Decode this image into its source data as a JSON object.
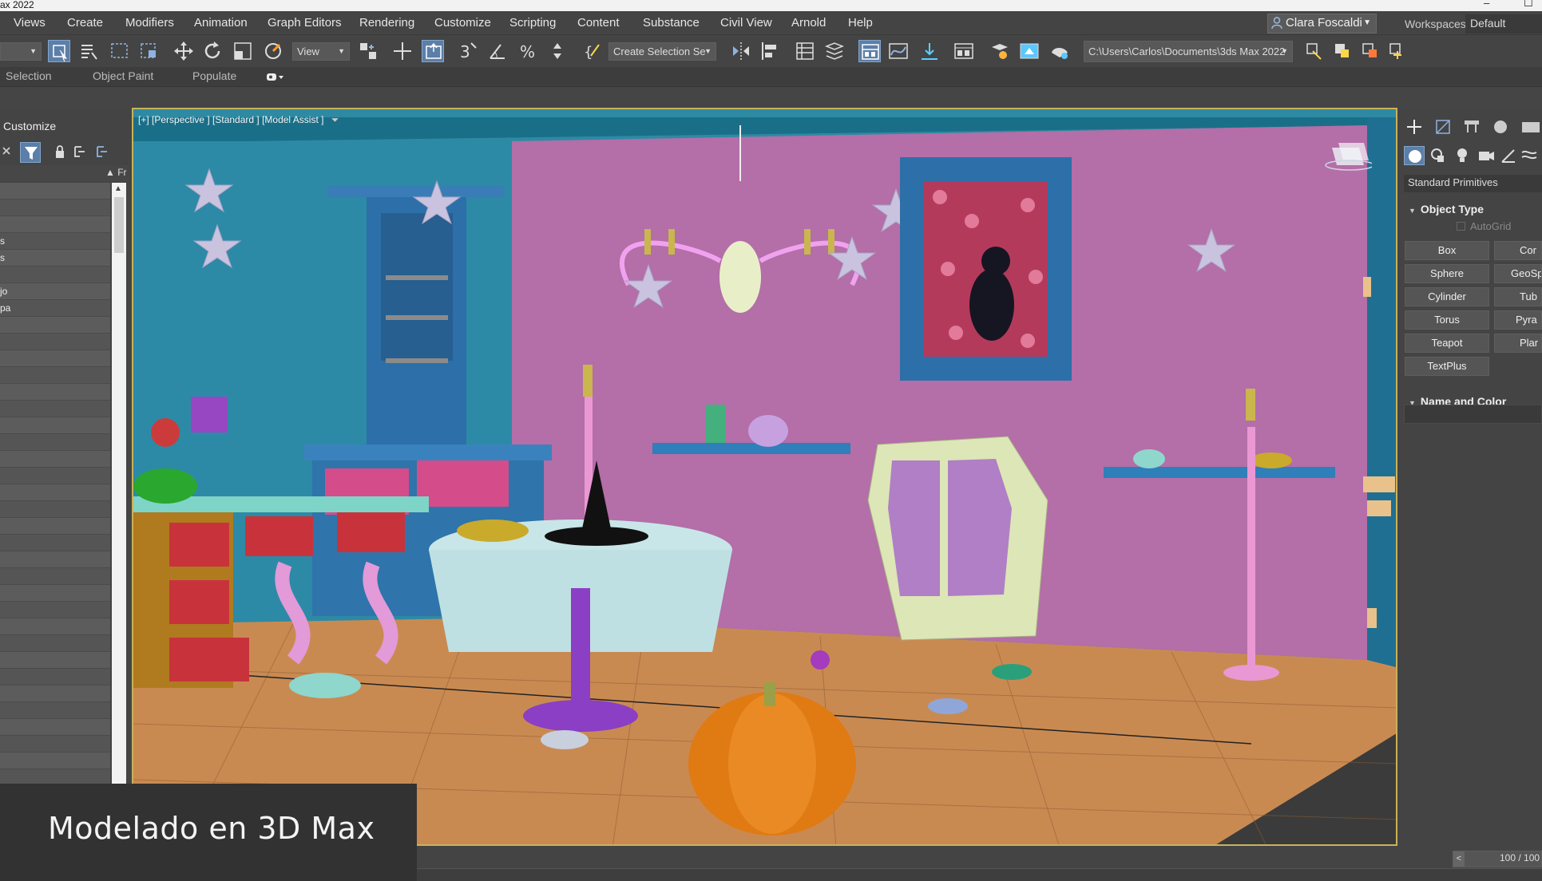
{
  "window": {
    "title": "ax 2022",
    "minimize": "–",
    "maximize": "☐"
  },
  "menu": {
    "items": [
      "Views",
      "Create",
      "Modifiers",
      "Animation",
      "Graph Editors",
      "Rendering",
      "Customize",
      "Scripting",
      "Content",
      "Substance",
      "Civil View",
      "Arnold",
      "Help"
    ],
    "user": "Clara Foscaldi",
    "workspaces_label": "Workspaces:",
    "workspaces_value": "Default"
  },
  "toolbar": {
    "view_dropdown": "View",
    "selection_set": "Create Selection Se",
    "project_path": "C:\\Users\\Carlos\\Documents\\3ds Max 2022",
    "accent": "#5b7fa8"
  },
  "ribbon": {
    "tabs": [
      "Selection",
      "Object Paint",
      "Populate"
    ]
  },
  "scene_explorer": {
    "title": "Customize",
    "column": "▲ Fr",
    "rows": [
      "",
      "",
      "",
      "s",
      "s",
      "",
      "jo",
      "pa",
      "",
      "",
      "",
      "",
      "",
      "",
      "",
      "",
      "",
      "",
      "",
      "",
      "",
      "",
      "",
      "",
      "",
      "",
      "",
      "",
      "",
      "",
      "",
      "",
      "",
      "",
      "",
      "",
      ""
    ]
  },
  "viewport": {
    "label": "[+] [Perspective ] [Standard ] [Model Assist ]",
    "border_color": "#c9b25a"
  },
  "command_panel": {
    "category": "Standard Primitives",
    "object_type": "Object Type",
    "autogrid": "AutoGrid",
    "primitives_left": [
      "Box",
      "Sphere",
      "Cylinder",
      "Torus",
      "Teapot",
      "TextPlus"
    ],
    "primitives_right": [
      "Cor",
      "GeoSp",
      "Tub",
      "Pyra",
      "Plar"
    ],
    "name_and_color": "Name and Color"
  },
  "timeline": {
    "frame": "100 / 100",
    "prev": "<"
  },
  "caption": "Modelado en 3D Max"
}
